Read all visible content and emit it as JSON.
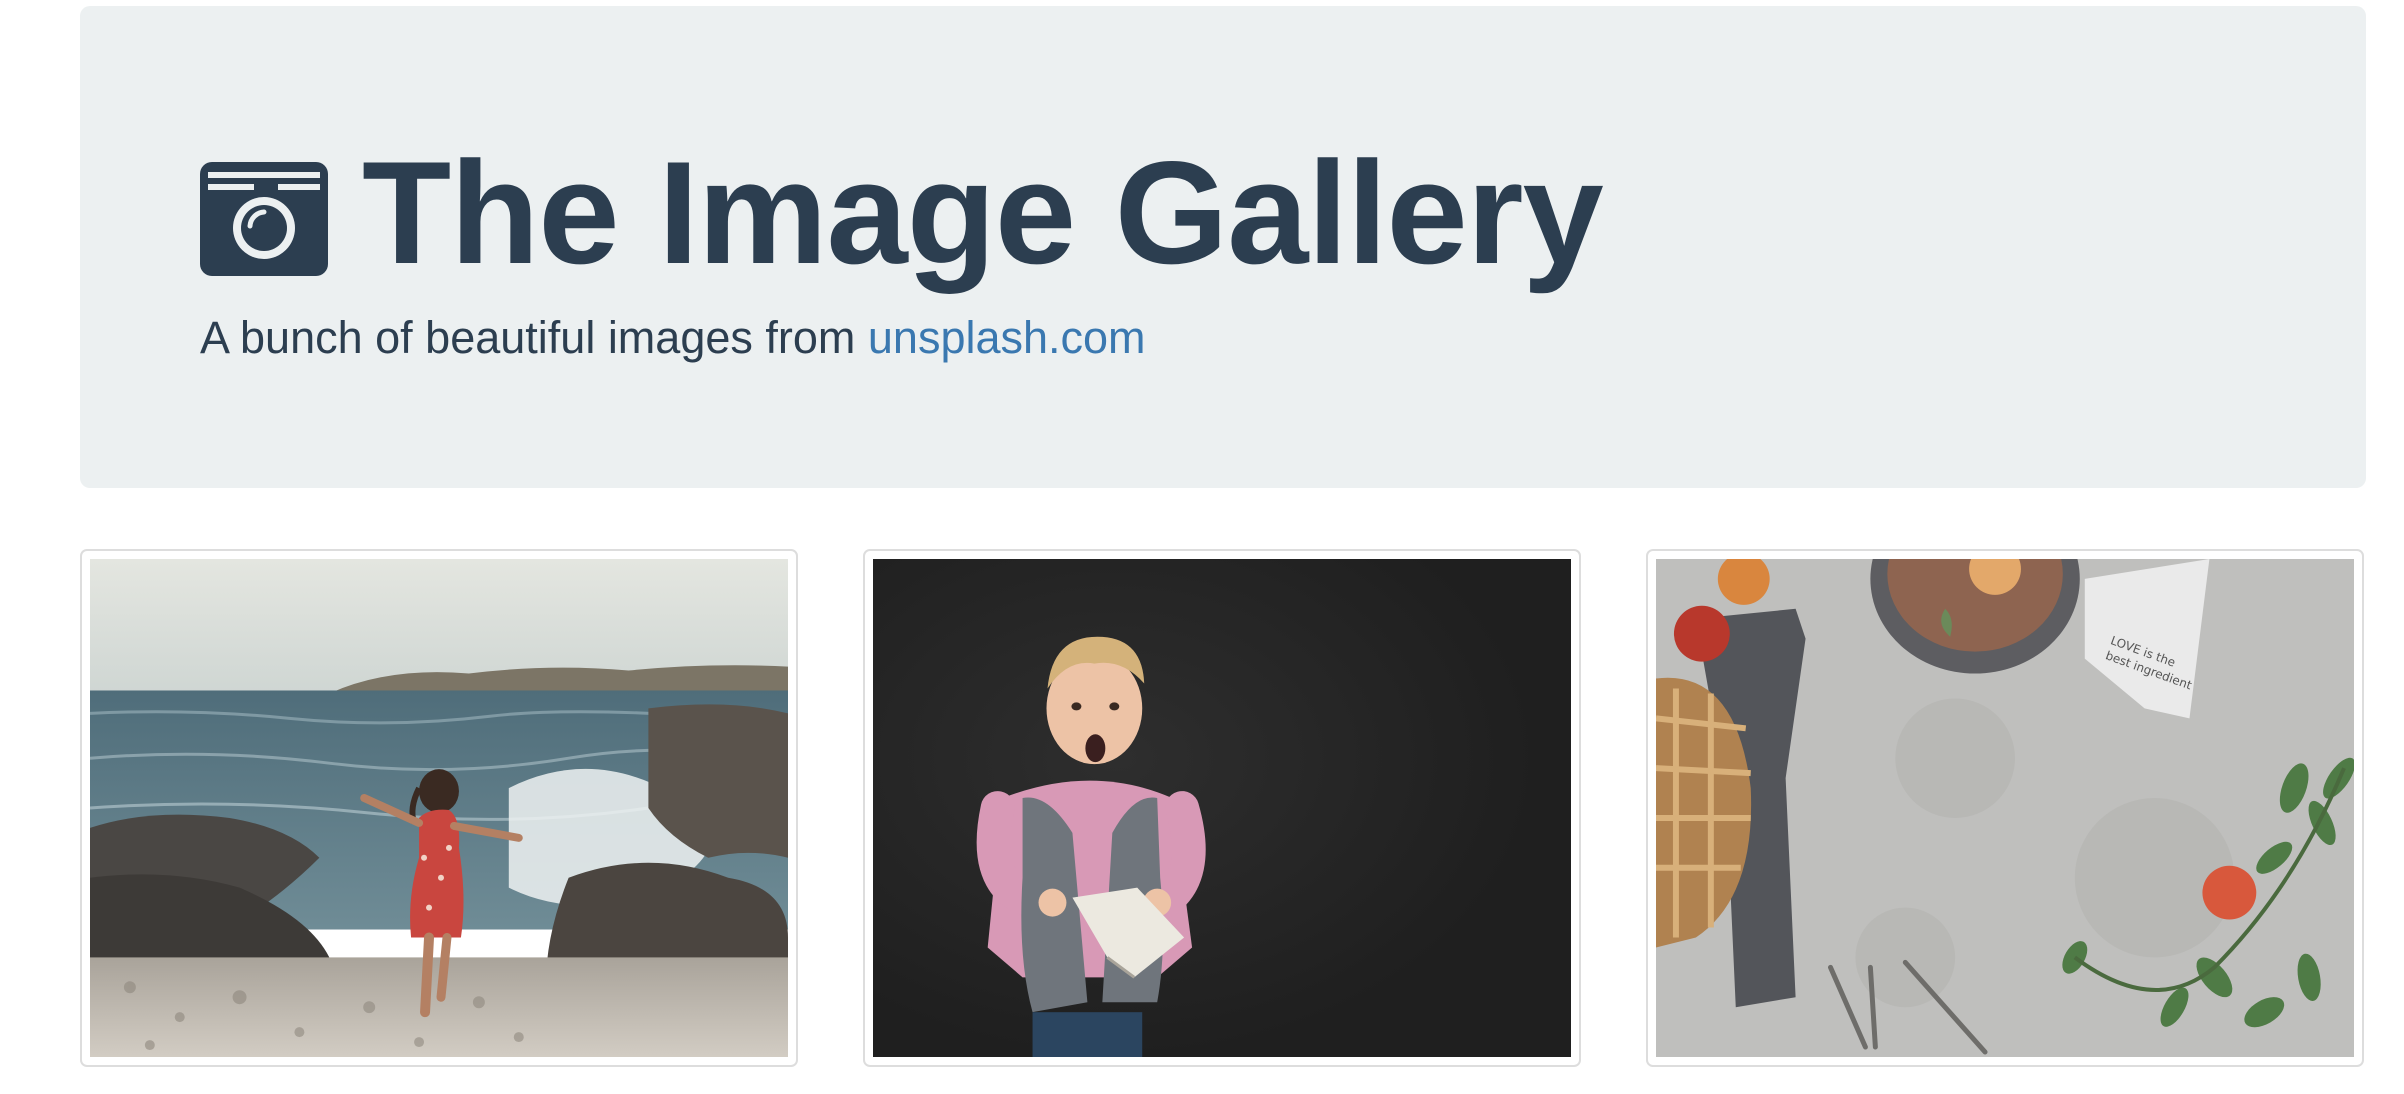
{
  "header": {
    "title": "The Image Gallery",
    "subtitle_prefix": "A bunch of beautiful images from ",
    "subtitle_link": "unsplash.com",
    "icon": "camera-icon"
  },
  "gallery": {
    "images": [
      {
        "name": "beach-girl-image"
      },
      {
        "name": "surprised-boy-image"
      },
      {
        "name": "pie-table-image"
      }
    ]
  },
  "colors": {
    "jumbotron_bg": "#ecf0f1",
    "title": "#2c3e50",
    "link": "#3a78b0"
  }
}
